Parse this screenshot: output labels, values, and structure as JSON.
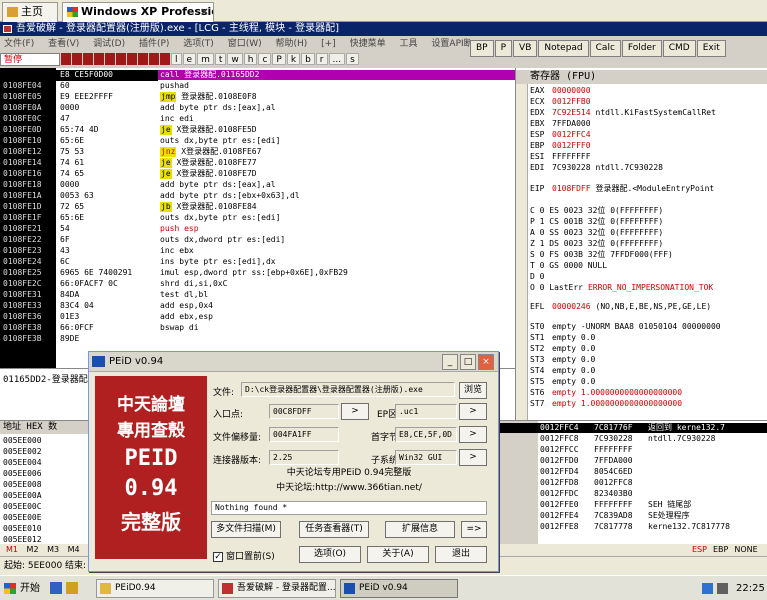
{
  "vm_tabs": [
    {
      "label": "主页"
    },
    {
      "label": "Windows XP Professional"
    }
  ],
  "debugger": {
    "title": "吾爱破解 - 登录器配置器(注册版).exe - [LCG - 主线程, 模块 - 登录器配]",
    "menu": [
      "文件(F)",
      "查看(V)",
      "调试(D)",
      "插件(P)",
      "选项(T)",
      "窗口(W)",
      "帮助(H)",
      "[+]",
      "快捷菜单",
      "工具",
      "设置API断点>"
    ],
    "right_toolbar": [
      "BP",
      "P",
      "VB",
      "Notepad",
      "Calc",
      "Folder",
      "CMD",
      "Exit"
    ],
    "state": "暂停",
    "letter_buttons": [
      "l",
      "e",
      "m",
      "t",
      "w",
      "h",
      "c",
      "P",
      "k",
      "b",
      "r",
      "...",
      "s"
    ],
    "disasm_rows": [
      {
        "addr": "0108FDFF",
        "hex": "E8 CE5F0D00",
        "parts": [
          {
            "t": "call 登录器配.01165DD2",
            "c": "pur"
          }
        ]
      },
      {
        "addr": "0108FE04",
        "hex": "60",
        "parts": [
          {
            "t": "pushad",
            "c": "mn"
          }
        ]
      },
      {
        "addr": "0108FE05",
        "hex": "E9 EEE2FFFF",
        "parts": [
          {
            "t": "jmp",
            "c": "tag"
          },
          {
            "t": " 登录器配.0108E0F8",
            "c": "mn"
          }
        ]
      },
      {
        "addr": "0108FE0A",
        "hex": "0000",
        "parts": [
          {
            "t": "add byte ptr ds:[eax],al",
            "c": "mn"
          }
        ]
      },
      {
        "addr": "0108FE0C",
        "hex": "47",
        "parts": [
          {
            "t": "inc edi",
            "c": "mn"
          }
        ]
      },
      {
        "addr": "0108FE0D",
        "hex": "65:74 4D",
        "parts": [
          {
            "t": "je",
            "c": "tag"
          },
          {
            "t": " X登录器配.0108FE5D",
            "c": "mn"
          }
        ]
      },
      {
        "addr": "0108FE10",
        "hex": "65:6E",
        "parts": [
          {
            "t": "outs dx,byte ptr es:[edi]",
            "c": "mn"
          }
        ]
      },
      {
        "addr": "0108FE12",
        "hex": "75 53",
        "parts": [
          {
            "t": "jnz",
            "c": "tag r"
          },
          {
            "t": " X登录器配.0108FE67",
            "c": "mn"
          }
        ]
      },
      {
        "addr": "0108FE14",
        "hex": "74 61",
        "parts": [
          {
            "t": "je",
            "c": "tag"
          },
          {
            "t": " X登录器配.0108FE77",
            "c": "mn"
          }
        ]
      },
      {
        "addr": "0108FE16",
        "hex": "74 65",
        "parts": [
          {
            "t": "je",
            "c": "tag"
          },
          {
            "t": " X登录器配.0108FE7D",
            "c": "mn"
          }
        ]
      },
      {
        "addr": "0108FE18",
        "hex": "0000",
        "parts": [
          {
            "t": "add byte ptr ds:[eax],al",
            "c": "mn"
          }
        ]
      },
      {
        "addr": "0108FE1A",
        "hex": "0053 63",
        "parts": [
          {
            "t": "add byte ptr ds:[ebx+0x63],dl",
            "c": "mn"
          }
        ]
      },
      {
        "addr": "0108FE1D",
        "hex": "72 65",
        "parts": [
          {
            "t": "jb",
            "c": "tag"
          },
          {
            "t": " X登录器配.0108FE84",
            "c": "mn"
          }
        ]
      },
      {
        "addr": "0108FE1F",
        "hex": "65:6E",
        "parts": [
          {
            "t": "outs dx,byte ptr es:[edi]",
            "c": "mn"
          }
        ]
      },
      {
        "addr": "0108FE21",
        "hex": "54",
        "parts": [
          {
            "t": "push esp",
            "c": "op-red"
          }
        ]
      },
      {
        "addr": "0108FE22",
        "hex": "6F",
        "parts": [
          {
            "t": "outs dx,dword ptr es:[edi]",
            "c": "mn"
          }
        ]
      },
      {
        "addr": "0108FE23",
        "hex": "43",
        "parts": [
          {
            "t": "inc ebx",
            "c": "mn"
          }
        ]
      },
      {
        "addr": "0108FE24",
        "hex": "6C",
        "parts": [
          {
            "t": "ins byte ptr es:[edi],dx",
            "c": "mn"
          }
        ]
      },
      {
        "addr": "0108FE25",
        "hex": "6965 6E 7400291",
        "parts": [
          {
            "t": "imul esp,dword ptr ss:[ebp+0x6E],0xFB29",
            "c": "mn"
          }
        ]
      },
      {
        "addr": "0108FE2C",
        "hex": "66:0FACF7 0C",
        "parts": [
          {
            "t": "shrd di,si,0xC",
            "c": "mn"
          }
        ]
      },
      {
        "addr": "0108FE31",
        "hex": "84DA",
        "parts": [
          {
            "t": "test dl,bl",
            "c": "mn"
          }
        ]
      },
      {
        "addr": "0108FE33",
        "hex": "83C4 04",
        "parts": [
          {
            "t": "add esp,0x4",
            "c": "mn"
          }
        ]
      },
      {
        "addr": "0108FE36",
        "hex": "01E3",
        "parts": [
          {
            "t": "add ebx,esp",
            "c": "mn"
          }
        ]
      },
      {
        "addr": "0108FE38",
        "hex": "66:0FCF",
        "parts": [
          {
            "t": "bswap di",
            "c": "mn"
          }
        ]
      },
      {
        "addr": "0108FE3B",
        "hex": "89DE",
        "parts": [
          {
            "t": "",
            "c": "mn"
          }
        ]
      }
    ],
    "disasm_status": "01165DD2-登录器配",
    "registers_title": "寄存器 (FPU)",
    "registers": [
      {
        "n": "EAX",
        "v": "00000000",
        "red": true,
        "c": ""
      },
      {
        "n": "ECX",
        "v": "0012FFB0",
        "red": true,
        "c": ""
      },
      {
        "n": "EDX",
        "v": "7C92E514",
        "red": true,
        "c": "ntdll.KiFastSystemCallRet"
      },
      {
        "n": "EBX",
        "v": "7FFDA000",
        "red": false,
        "c": ""
      },
      {
        "n": "ESP",
        "v": "0012FFC4",
        "red": true,
        "c": ""
      },
      {
        "n": "EBP",
        "v": "0012FFF0",
        "red": true,
        "c": ""
      },
      {
        "n": "ESI",
        "v": "FFFFFFFF",
        "red": false,
        "c": ""
      },
      {
        "n": "EDI",
        "v": "7C930228",
        "red": false,
        "c": "ntdll.7C930228"
      }
    ],
    "eip": {
      "n": "EIP",
      "v": "0108FDFF",
      "c": "登录器配.<ModuleEntryPoint"
    },
    "flags": [
      "C 0  ES 0023 32位 0(FFFFFFFF)",
      "P 1  CS 001B 32位 0(FFFFFFFF)",
      "A 0  SS 0023 32位 0(FFFFFFFF)",
      "Z 1  DS 0023 32位 0(FFFFFFFF)",
      "S 0  FS 003B 32位 7FFDF000(FFF)",
      "T 0  GS 0000 NULL",
      "D 0",
      "O 0  LastErr"
    ],
    "lasterr": "ERROR_NO_IMPERSONATION_TOK",
    "efl": {
      "n": "EFL",
      "v": "00000246",
      "c": "(NO,NB,E,BE,NS,PE,GE,LE)"
    },
    "fpu": [
      {
        "n": "ST0",
        "v": "empty -UNORM BAA8 01050104 00000000",
        "red": false
      },
      {
        "n": "ST1",
        "v": "empty 0.0",
        "red": false
      },
      {
        "n": "ST2",
        "v": "empty 0.0",
        "red": false
      },
      {
        "n": "ST3",
        "v": "empty 0.0",
        "red": false
      },
      {
        "n": "ST4",
        "v": "empty 0.0",
        "red": false
      },
      {
        "n": "ST5",
        "v": "empty 0.0",
        "red": false
      },
      {
        "n": "ST6",
        "v": "empty 1.0000000000000000000",
        "red": true
      },
      {
        "n": "ST7",
        "v": "empty 1.0000000000000000000",
        "red": true
      }
    ],
    "dump_header": "地址  HEX 数",
    "dump_rows": [
      "005EE000",
      "005EE002",
      "005EE004",
      "005EE006",
      "005EE008",
      "005EE00A",
      "005EE00C",
      "005EE00E",
      "005EE010",
      "005EE012"
    ],
    "stack_rows": [
      {
        "a": "0012FFC4",
        "v": "7C81776F",
        "c": "返回到 kerne132.7",
        "sel": true
      },
      {
        "a": "0012FFC8",
        "v": "7C930228",
        "c": "ntdll.7C930228",
        "sel": false
      },
      {
        "a": "0012FFCC",
        "v": "FFFFFFFF",
        "c": "",
        "sel": false
      },
      {
        "a": "0012FFD0",
        "v": "7FFDA000",
        "c": "",
        "sel": false
      },
      {
        "a": "0012FFD4",
        "v": "8054C6ED",
        "c": "",
        "sel": false
      },
      {
        "a": "0012FFD8",
        "v": "0012FFC8",
        "c": "",
        "sel": false
      },
      {
        "a": "0012FFDC",
        "v": "823403B0",
        "c": "",
        "sel": false
      },
      {
        "a": "0012FFE0",
        "v": "FFFFFFFF",
        "c": "SEH 链尾部",
        "sel": false
      },
      {
        "a": "0012FFE4",
        "v": "7C839AD8",
        "c": "SE处理程序",
        "sel": false
      },
      {
        "a": "0012FFE8",
        "v": "7C817778",
        "c": "kerne132.7C817778",
        "sel": false
      }
    ],
    "bottom_tabs": [
      "M1",
      "M2",
      "M3",
      "M4",
      "M5"
    ],
    "bottom_right": [
      "ESP",
      "EBP",
      "NONE"
    ],
    "status": "起始: 5EE000 结束:"
  },
  "peid": {
    "title": "PEiD v0.94",
    "logo_lines": [
      "中天論壇",
      "專用查殼",
      "PEID",
      "0.94",
      "完整版"
    ],
    "file_label": "文件:",
    "file_value": "D:\\ck登录器配置器\\登录器配置器(注册版).exe",
    "browse_label": "浏览",
    "entry_label": "入口点:",
    "entry_value": "00C8FDFF",
    "ep_section_label": "EP区段:",
    "ep_section_value": ".uc1",
    "file_offset_label": "文件偏移量:",
    "file_offset_value": "004FA1FF",
    "first_bytes_label": "首字节:",
    "first_bytes_value": "E8,CE,5F,0D",
    "linker_label": "连接器版本:",
    "linker_value": "2.25",
    "subsystem_label": "子系统:",
    "subsystem_value": "Win32 GUI",
    "info_line1": "中天论坛专用PEiD 0.94完整版",
    "info_line2": "中天论坛:http://www.366tian.net/",
    "result": "Nothing found *",
    "multi_scan": "多文件扫描(M)",
    "task_viewer": "任务查看器(T)",
    "ext_info": "扩展信息",
    "arrow_btn": "=>",
    "always_on_top": "窗口置前(S)",
    "options": "选项(O)",
    "about": "关于(A)",
    "exit": "退出"
  },
  "taskbar": {
    "start": "开始",
    "tasks": [
      "PEiD0.94",
      "吾爱破解 - 登录器配置...",
      "PEiD v0.94"
    ],
    "clock": "22:25"
  }
}
